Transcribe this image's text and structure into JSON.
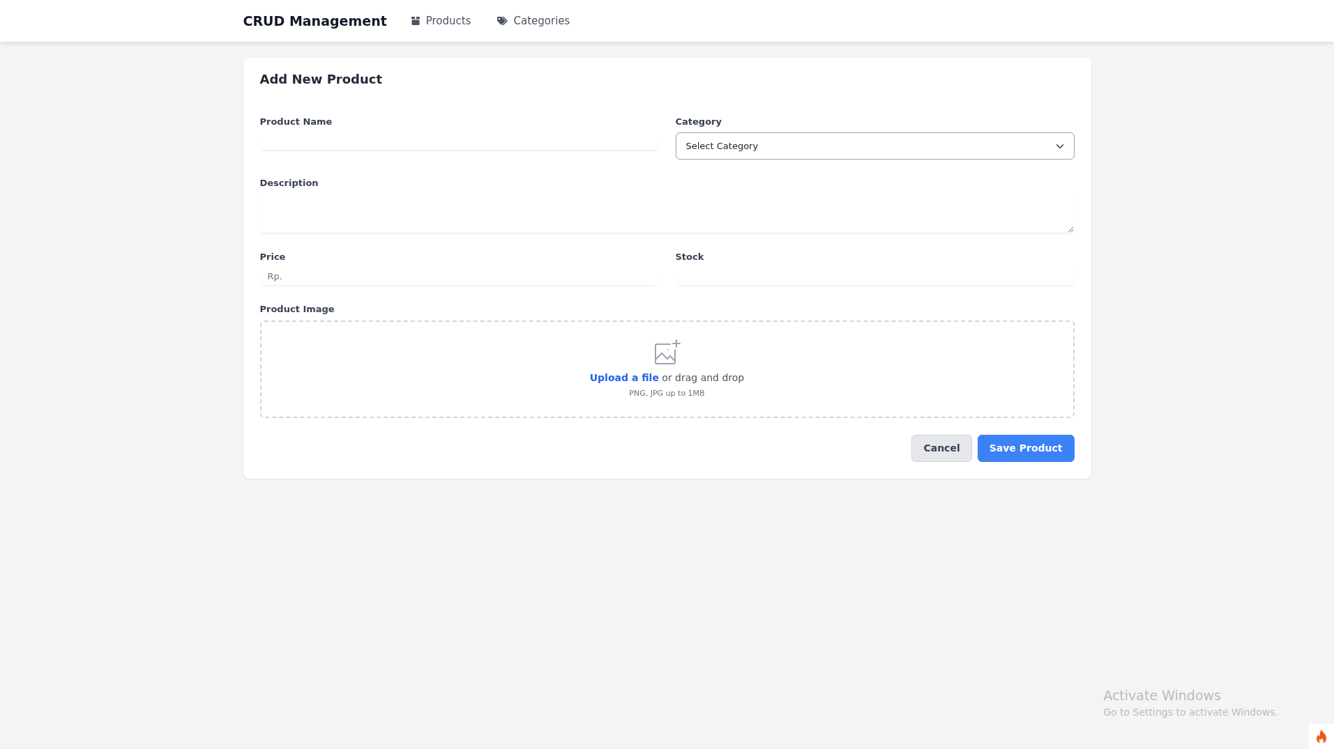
{
  "navbar": {
    "brand": "CRUD Management",
    "links": [
      {
        "label": "Products",
        "selected": false
      },
      {
        "label": "Categories",
        "selected": false
      }
    ]
  },
  "form": {
    "title": "Add New Product",
    "fields": [
      {
        "kind": "text",
        "label": "Product Name"
      },
      {
        "kind": "select",
        "label": "Category",
        "value": "Select Category"
      },
      {
        "kind": "textarea",
        "label": "Description"
      },
      {
        "kind": "text",
        "label": "Price",
        "prefix": "Rp."
      },
      {
        "kind": "text",
        "label": "Stock"
      }
    ],
    "image": {
      "label": "Product Image",
      "link": "Upload a file",
      "text": "or drag and drop",
      "hint": "PNG, JPG up to 1MB"
    },
    "buttons": [
      {
        "label": "Cancel",
        "kind": "secondary"
      },
      {
        "label": "Save Product",
        "kind": "primary"
      }
    ]
  },
  "os_overlay": {
    "title": "Activate Windows",
    "text": "Go to Settings to activate Windows."
  }
}
